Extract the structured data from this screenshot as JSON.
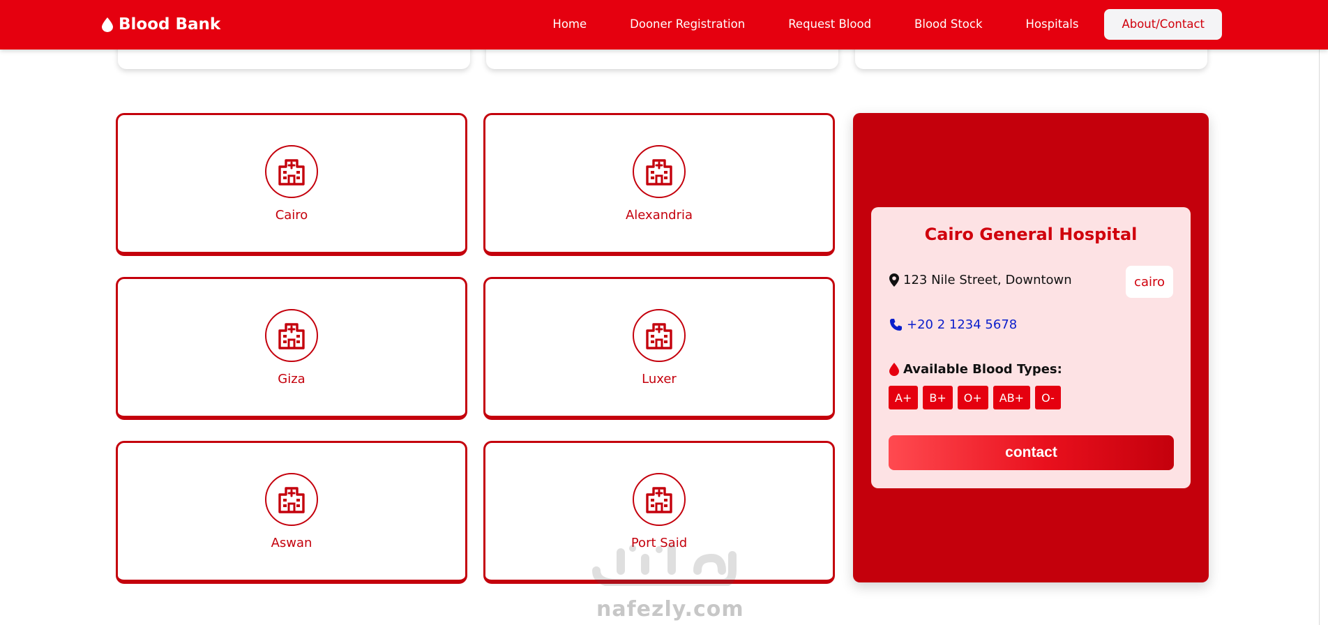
{
  "brand": {
    "name": "Blood Bank",
    "icon": "blood-drop-icon"
  },
  "nav": [
    {
      "label": "Home",
      "active": false
    },
    {
      "label": "Dooner Registration",
      "active": false
    },
    {
      "label": "Request Blood",
      "active": false
    },
    {
      "label": "Blood Stock",
      "active": false
    },
    {
      "label": "Hospitals",
      "active": false
    },
    {
      "label": "About/Contact",
      "active": true
    }
  ],
  "cities": [
    {
      "name": "Cairo",
      "icon": "hospital-icon"
    },
    {
      "name": "Alexandria",
      "icon": "hospital-icon"
    },
    {
      "name": "Giza",
      "icon": "hospital-icon"
    },
    {
      "name": "Luxer",
      "icon": "hospital-icon"
    },
    {
      "name": "Aswan",
      "icon": "hospital-icon"
    },
    {
      "name": "Port Said",
      "icon": "hospital-icon"
    }
  ],
  "hospital": {
    "name": "Cairo General Hospital",
    "address": "123 Nile Street, Downtown",
    "city": "cairo",
    "phone": "+20 2 1234 5678",
    "blood_types_label": "Available Blood Types:",
    "blood_types": [
      "A+",
      "B+",
      "O+",
      "AB+",
      "O-"
    ],
    "contact_label": "contact"
  },
  "watermark": {
    "text": "nafezly.com"
  },
  "colors": {
    "primary": "#e5000f",
    "dark_red": "#c4000c",
    "card_pink": "#fde2e4",
    "phone_blue": "#0a1ecc"
  }
}
